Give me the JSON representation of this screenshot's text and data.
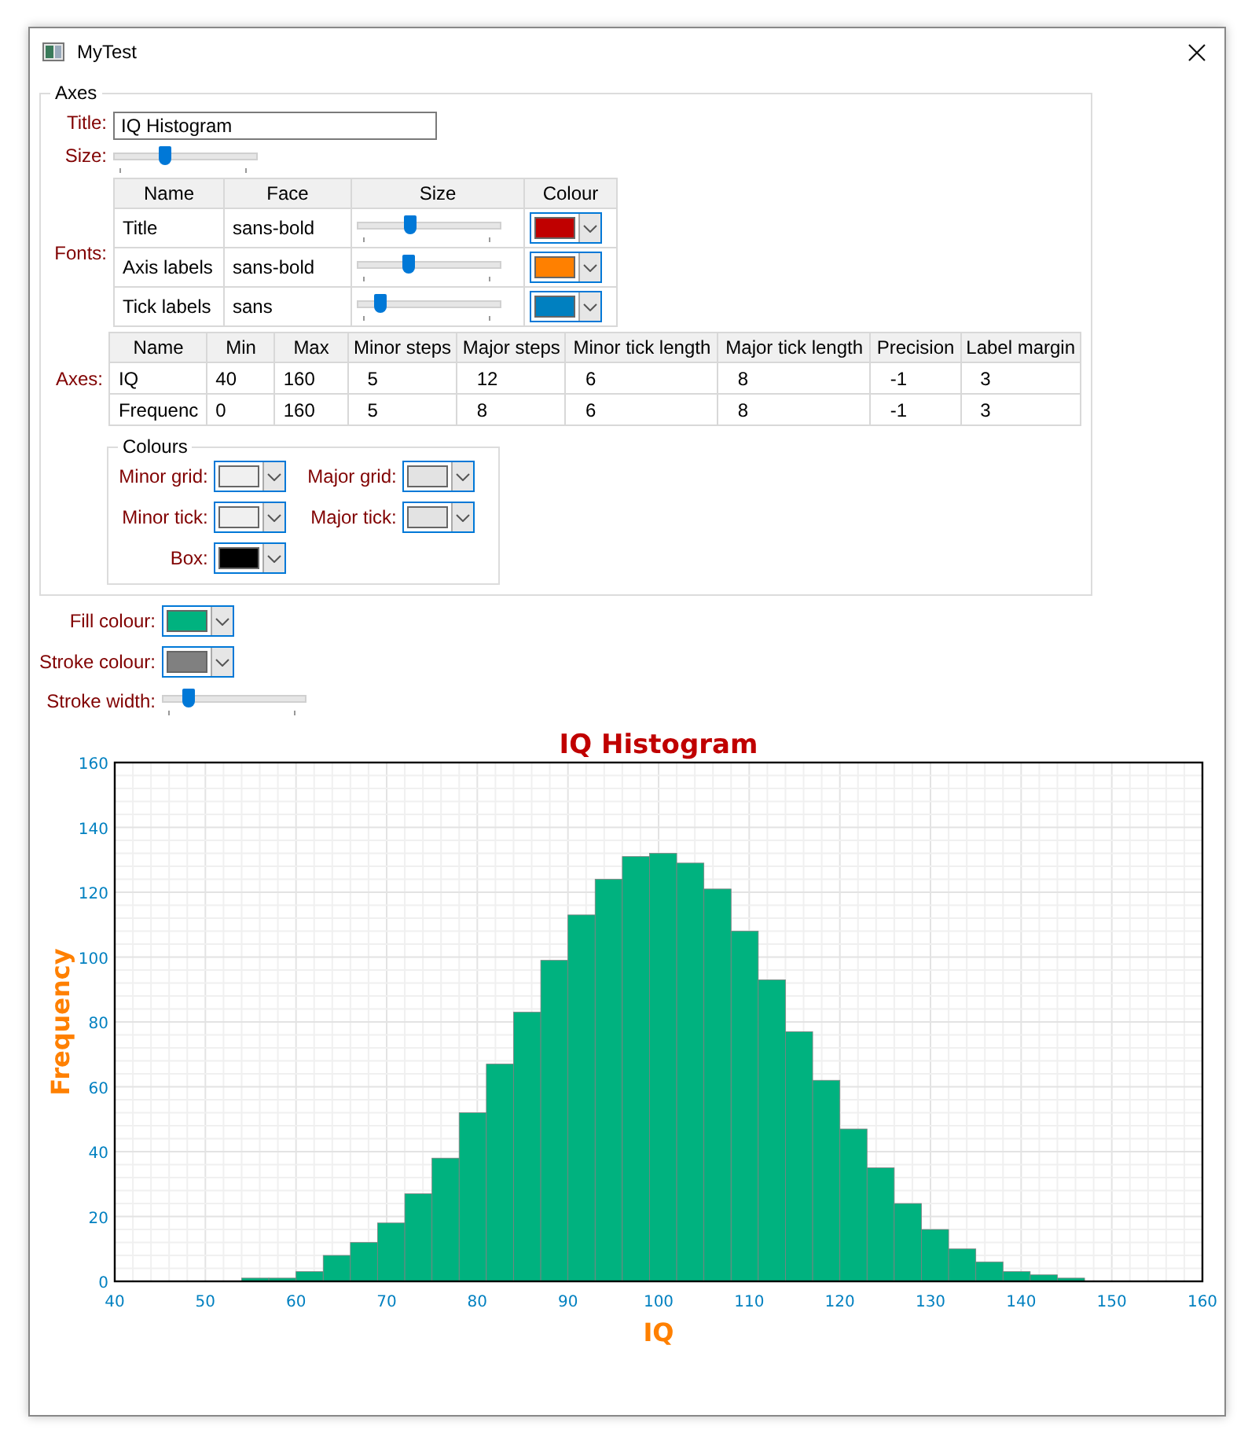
{
  "window": {
    "title": "MyTest"
  },
  "axes_group": {
    "title": "Axes",
    "title_field": {
      "label": "Title:",
      "value": "IQ Histogram"
    },
    "size": {
      "label": "Size:",
      "level": 0.35
    },
    "fonts": {
      "label": "Fonts:",
      "columns": [
        "Name",
        "Face",
        "Size",
        "Colour"
      ],
      "rows": [
        {
          "name": "Title",
          "face": "sans-bold",
          "level": 0.36,
          "color": "#c00000"
        },
        {
          "name": "Axis labels",
          "face": "sans-bold",
          "level": 0.34,
          "color": "#ff8000"
        },
        {
          "name": "Tick labels",
          "face": "sans",
          "level": 0.13,
          "color": "#0080c0"
        }
      ]
    },
    "axes": {
      "label": "Axes:",
      "columns": [
        "Name",
        "Min",
        "Max",
        "Minor steps",
        "Major steps",
        "Minor tick length",
        "Major tick length",
        "Precision",
        "Label margin"
      ],
      "rows": [
        [
          "IQ",
          "40",
          "160",
          "5",
          "12",
          "6",
          "8",
          "-1",
          "3"
        ],
        [
          "Frequenc",
          "0",
          "160",
          "5",
          "8",
          "6",
          "8",
          "-1",
          "3"
        ]
      ]
    },
    "colours": {
      "title": "Colours",
      "items": [
        {
          "label": "Minor grid:",
          "color": "#f0f0f0"
        },
        {
          "label": "Major grid:",
          "color": "#e3e3e3"
        },
        {
          "label": "Minor tick:",
          "color": "#f0f0f0"
        },
        {
          "label": "Major tick:",
          "color": "#e3e3e3"
        },
        {
          "label": "Box:",
          "color": "#000000"
        }
      ]
    }
  },
  "fill_colour": {
    "label": "Fill colour:",
    "color": "#00b27f"
  },
  "stroke_colour": {
    "label": "Stroke colour:",
    "color": "#808080"
  },
  "stroke_width": {
    "label": "Stroke width:",
    "level": 0.15
  },
  "chart": {
    "chart_data": {
      "type": "bar",
      "title": "IQ Histogram",
      "xlabel": "IQ",
      "ylabel": "Frequency",
      "x": [
        55.5,
        58.5,
        61.5,
        64.5,
        67.5,
        70.5,
        73.5,
        76.5,
        79.5,
        82.5,
        85.5,
        88.5,
        91.5,
        94.5,
        97.5,
        100.5,
        103.5,
        106.5,
        109.5,
        112.5,
        115.5,
        118.5,
        121.5,
        124.5,
        127.5,
        130.5,
        133.5,
        136.5,
        139.5,
        142.5,
        145.5
      ],
      "values": [
        1,
        1,
        3,
        8,
        12,
        18,
        27,
        38,
        52,
        67,
        83,
        99,
        113,
        124,
        131,
        132,
        129,
        121,
        108,
        93,
        77,
        62,
        47,
        35,
        24,
        16,
        10,
        6,
        3,
        2,
        1
      ],
      "grid": true,
      "xlim": [
        40,
        160
      ],
      "ylim": [
        0,
        160
      ],
      "xticks": [
        40,
        50,
        60,
        70,
        80,
        90,
        100,
        110,
        120,
        130,
        140,
        150,
        160
      ],
      "yticks": [
        0,
        20,
        40,
        60,
        80,
        100,
        120,
        140,
        160
      ]
    }
  }
}
